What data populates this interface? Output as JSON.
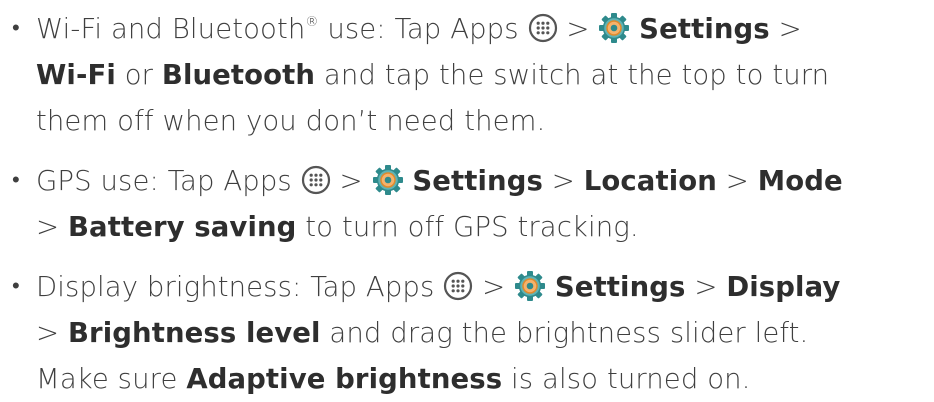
{
  "bullets": [
    {
      "bullet": "•",
      "wifi_label": "Wi-Fi and Bluetooth",
      "registered": "®",
      "use_tap": " use: Tap Apps ",
      "sep1": " > ",
      "settings": "Settings",
      "sep2": " >",
      "wifi": "Wi-Fi",
      "or": " or ",
      "bluetooth": "Bluetooth",
      "rest1": " and tap the switch at the top to turn",
      "rest2": "them off when you don’t need them."
    },
    {
      "bullet": "•",
      "lead": "GPS use: Tap Apps ",
      "sep1": " > ",
      "settings": "Settings",
      "sep2": " > ",
      "location": "Location",
      "sep3": " > ",
      "mode": "Mode",
      "sep4": "> ",
      "battery_saving": "Battery saving",
      "rest": " to turn off GPS tracking."
    },
    {
      "bullet": "•",
      "lead": "Display brightness: Tap Apps ",
      "sep1": " > ",
      "settings": "Settings",
      "sep2": " > ",
      "display": "Display",
      "sep3": "> ",
      "brightness_level": "Brightness level",
      "rest1": " and drag the brightness slider left.",
      "make_sure": "Make sure ",
      "adaptive": "Adaptive brightness",
      "rest2": " is also turned on."
    }
  ],
  "icons": {
    "apps": "apps-icon",
    "settings": "settings-gear-icon"
  },
  "colors": {
    "text": "#3f3f3f",
    "icon_gray": "#555555",
    "gear_teal": "#2e8a8c",
    "gear_teal_light": "#5fb3b5",
    "gear_orange": "#f6b26b",
    "gear_orange_dark": "#e08a2c"
  }
}
